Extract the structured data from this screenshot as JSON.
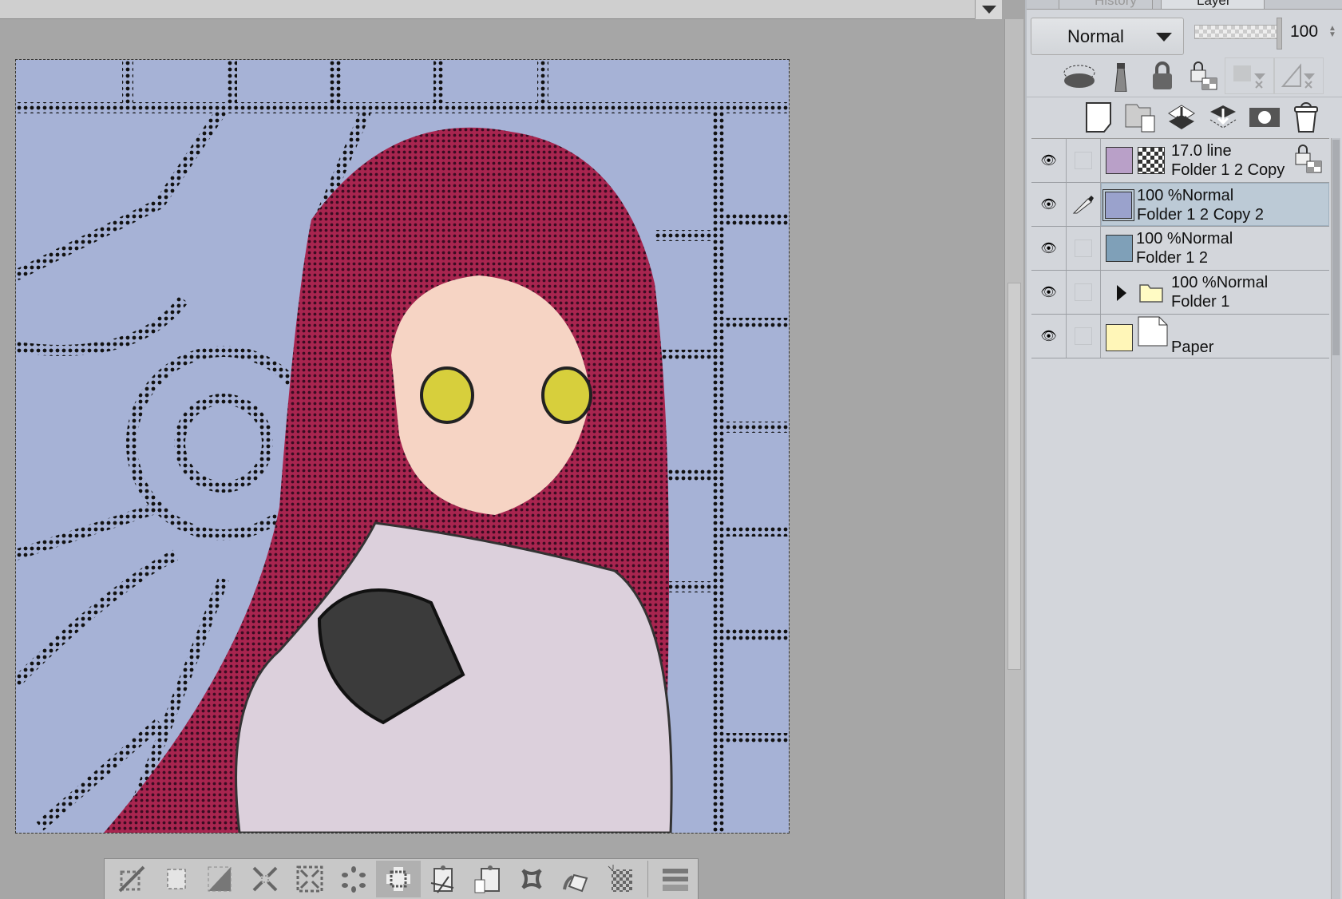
{
  "panel": {
    "tabs": [
      {
        "label": "History",
        "icon": "history-icon"
      },
      {
        "label": "Layer",
        "icon": "layer-icon"
      }
    ],
    "blend_mode": "Normal",
    "opacity": "100",
    "layer_props_icons": [
      "clip-to-below-icon",
      "reference-layer-icon",
      "lock-layer-icon",
      "lock-transparency-icon",
      "mask-disabled-icon",
      "ruler-disabled-icon"
    ],
    "layer_action_icons": [
      "new-raster-layer-icon",
      "new-folder-icon",
      "transfer-down-icon",
      "merge-down-icon",
      "layer-mask-icon",
      "delete-layer-icon"
    ],
    "layers": [
      {
        "line1": "17.0 line",
        "line2": "Folder 1 2 Copy",
        "selected": false,
        "type": "tone",
        "locked": true
      },
      {
        "line1": "100 %Normal",
        "line2": "Folder 1 2 Copy 2",
        "selected": true,
        "type": "raster",
        "editing": true
      },
      {
        "line1": "100 %Normal",
        "line2": "Folder 1 2",
        "selected": false,
        "type": "raster"
      },
      {
        "line1": "100 %Normal",
        "line2": "Folder 1",
        "selected": false,
        "type": "folder"
      },
      {
        "line1": "",
        "line2": "Paper",
        "selected": false,
        "type": "paper",
        "color": "#fff6b8"
      }
    ]
  },
  "bottom_toolbar": [
    "deselect-icon",
    "select-all-icon",
    "invert-selection-icon",
    "expand-selection-icon",
    "shrink-selection-icon",
    "scatter-icon",
    "selection-border-icon",
    "cut-paste-icon",
    "copy-paste-icon",
    "transform-icon",
    "fill-icon",
    "tone-icon",
    "settings-bar-icon"
  ],
  "colors": {
    "canvas_bg": "#a6a6a6",
    "art_bg": "#a6b2d6",
    "hair": "#8a1f4a",
    "selected_layer": "#bccad6"
  }
}
